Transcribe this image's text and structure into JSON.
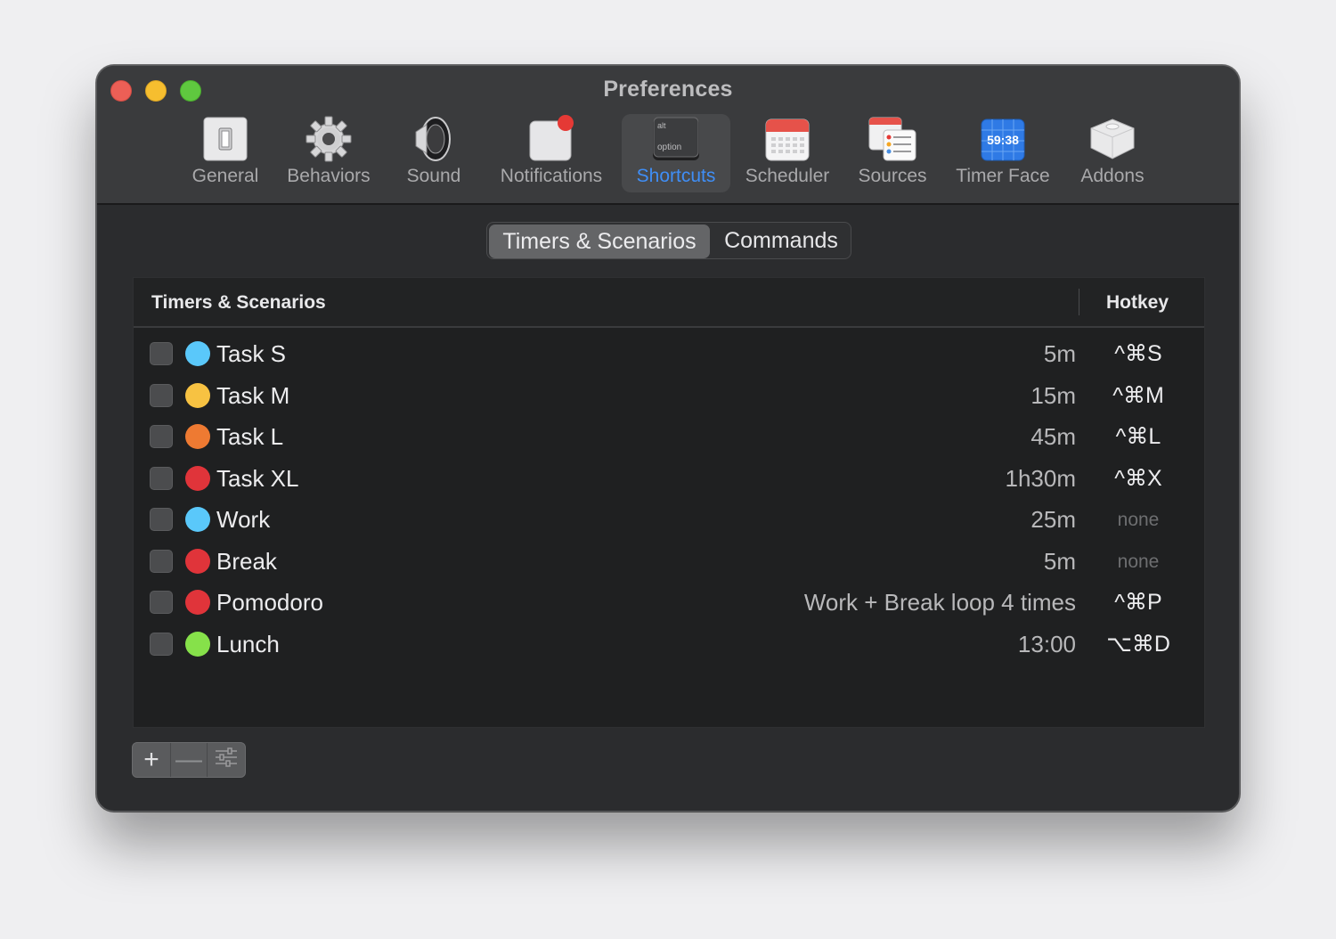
{
  "window": {
    "title": "Preferences"
  },
  "toolbar": {
    "items": [
      {
        "label": "General",
        "icon": "general-switch-icon"
      },
      {
        "label": "Behaviors",
        "icon": "gear-icon"
      },
      {
        "label": "Sound",
        "icon": "speaker-icon"
      },
      {
        "label": "Notifications",
        "icon": "notification-badge-icon"
      },
      {
        "label": "Shortcuts",
        "icon": "option-key-icon",
        "key_top": "alt",
        "key_bottom": "option"
      },
      {
        "label": "Scheduler",
        "icon": "calendar-icon"
      },
      {
        "label": "Sources",
        "icon": "sources-list-icon"
      },
      {
        "label": "Timer Face",
        "icon": "timer-face-icon",
        "display": "59:38"
      },
      {
        "label": "Addons",
        "icon": "addon-cube-icon"
      }
    ],
    "active": "Shortcuts",
    "accent_color": "#3f8ef6"
  },
  "segments": {
    "selected": "Timers & Scenarios",
    "other": "Commands"
  },
  "table": {
    "headers": {
      "name": "Timers & Scenarios",
      "hotkey": "Hotkey"
    },
    "rows": [
      {
        "name": "Task S",
        "color": "#5ac8fa",
        "duration": "5m",
        "hotkey": "^⌘S",
        "checked": false
      },
      {
        "name": "Task M",
        "color": "#f7c242",
        "duration": "15m",
        "hotkey": "^⌘M",
        "checked": false
      },
      {
        "name": "Task L",
        "color": "#ee7a32",
        "duration": "45m",
        "hotkey": "^⌘L",
        "checked": false
      },
      {
        "name": "Task XL",
        "color": "#e0343a",
        "duration": "1h30m",
        "hotkey": "^⌘X",
        "checked": false
      },
      {
        "name": "Work",
        "color": "#5ac8fa",
        "duration": "25m",
        "hotkey": "none",
        "checked": false
      },
      {
        "name": "Break",
        "color": "#e0343a",
        "duration": "5m",
        "hotkey": "none",
        "checked": false
      },
      {
        "name": "Pomodoro",
        "color": "#e0343a",
        "duration": "Work + Break loop 4 times",
        "hotkey": "^⌘P",
        "checked": false
      },
      {
        "name": "Lunch",
        "color": "#86e14a",
        "duration": "13:00",
        "hotkey": "⌥⌘D",
        "checked": false
      }
    ]
  },
  "bottom_bar": {
    "add": "+",
    "remove": "—",
    "settings_icon": "sliders-icon"
  }
}
